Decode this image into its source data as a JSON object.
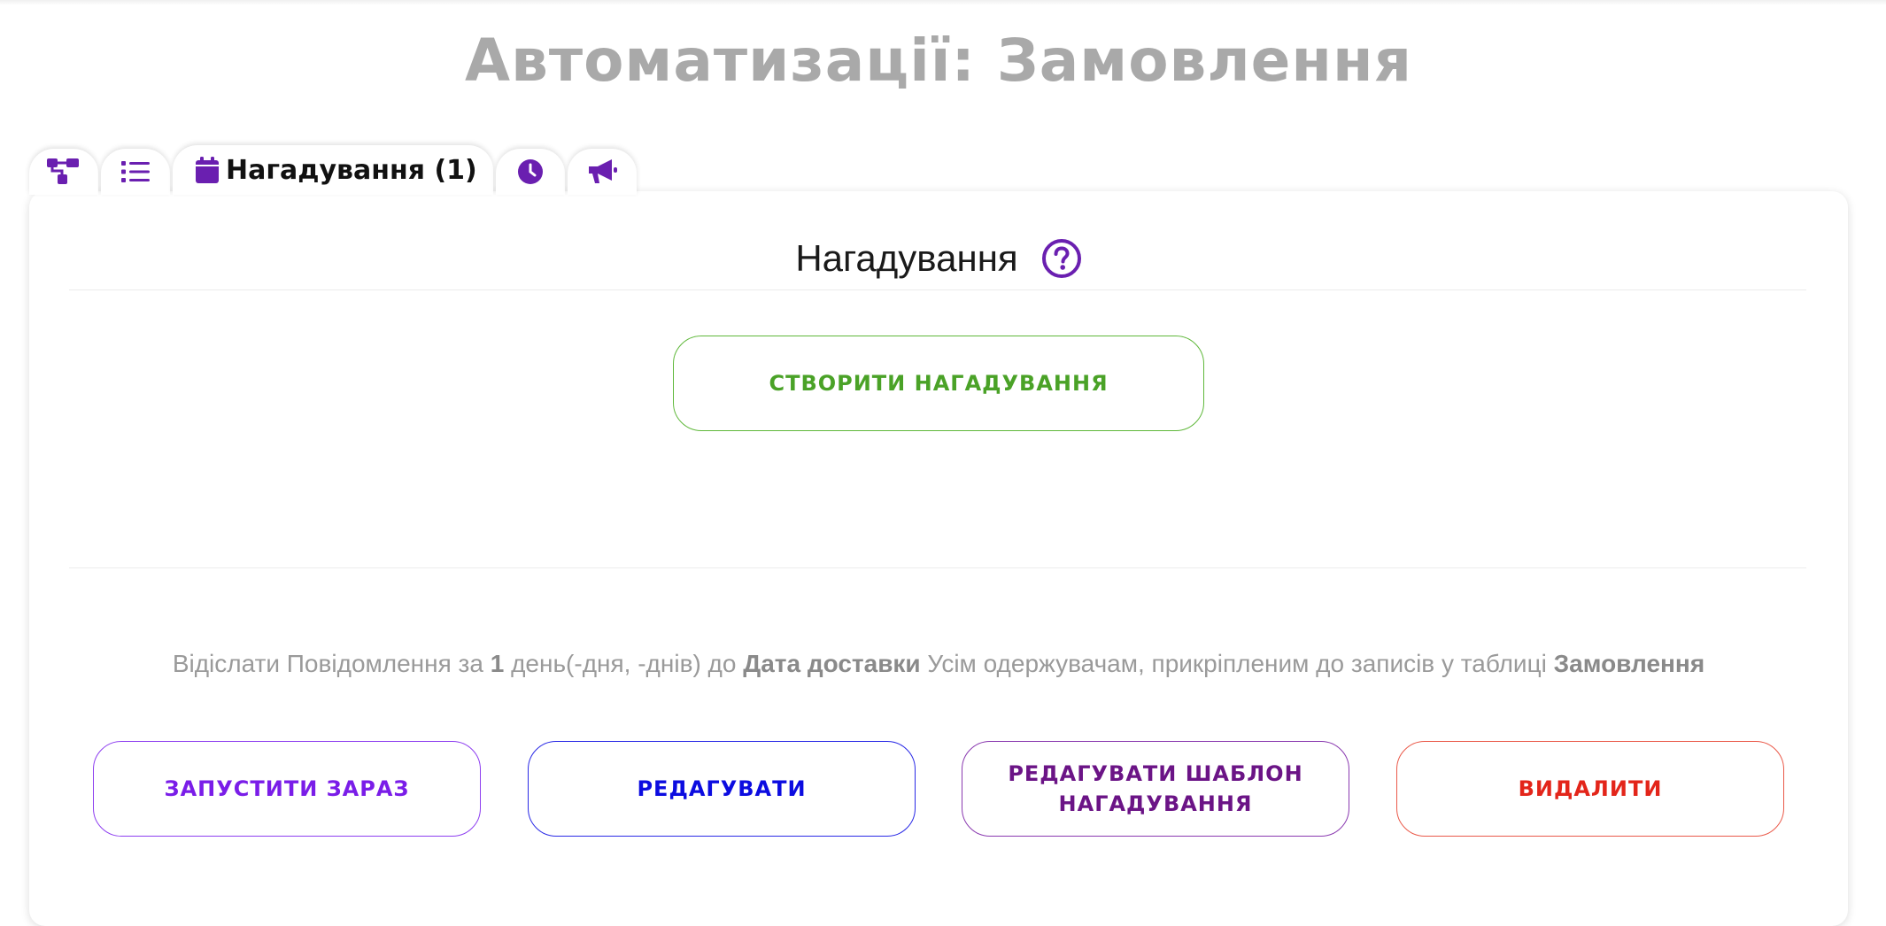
{
  "page": {
    "title": "Автоматизації: Замовлення"
  },
  "tabs": [
    {
      "icon": "sitemap-icon",
      "label": ""
    },
    {
      "icon": "list-icon",
      "label": ""
    },
    {
      "icon": "calendar-icon",
      "label": "Нагадування (1)",
      "active": true
    },
    {
      "icon": "clock-icon",
      "label": ""
    },
    {
      "icon": "megaphone-icon",
      "label": ""
    }
  ],
  "section": {
    "title": "Нагадування",
    "help_icon": "question-circle-icon",
    "create_button": "Створити нагадування"
  },
  "reminder": {
    "desc_prefix": "Відіслати Повідомлення за ",
    "days": "1",
    "desc_days_suffix": " день(-дня, -днів) до ",
    "date_field": "Дата доставки",
    "desc_middle": " Усім одержувачам, прикріпленим до записів у таблиці ",
    "table_name": "Замовлення",
    "run_now_button": "Запустити зараз",
    "edit_button": "Редагувати",
    "edit_template_button": "Редагувати шаблон нагадування",
    "delete_button": "Видалити"
  },
  "colors": {
    "accent_purple": "#6a1fb0",
    "create_green": "#4aa227",
    "run_purple": "#7a1de8",
    "edit_blue": "#0c0ce0",
    "template_purple": "#6b1486",
    "delete_red": "#e3251a",
    "title_gray": "#a9a9a9"
  }
}
